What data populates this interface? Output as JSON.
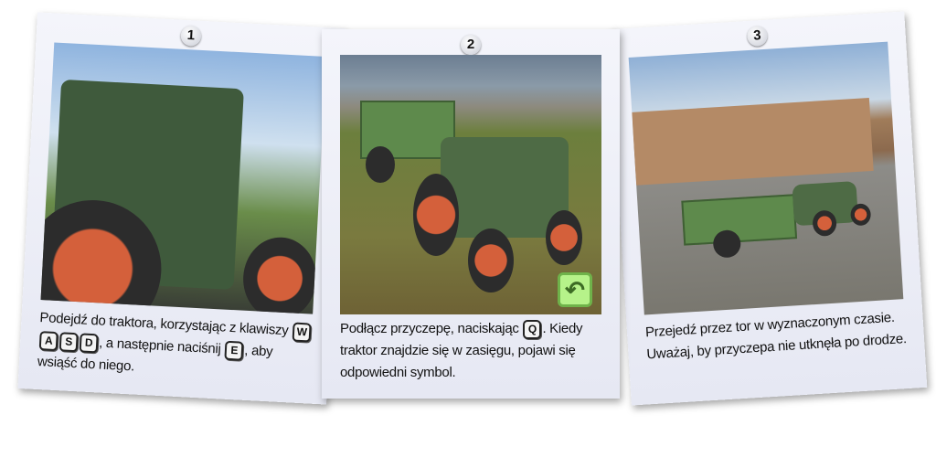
{
  "cards": [
    {
      "number": "1",
      "caption_parts": [
        "Podejdź do traktora, korzystając z klawiszy ",
        ", a następnie naciśnij ",
        ", aby wsiąść do niego."
      ],
      "keys_move": [
        "W",
        "A",
        "S",
        "D"
      ],
      "key_enter": "E"
    },
    {
      "number": "2",
      "caption_parts": [
        "Podłącz przyczepę, naciskając ",
        ". Kiedy traktor znajdzie się w zasięgu, pojawi się odpowiedni symbol."
      ],
      "key_attach": "Q",
      "icon": "attach-symbol-icon",
      "icon_color": "#b6f28a"
    },
    {
      "number": "3",
      "caption": "Przejedź przez tor w wyznaczonym czasie. Uważaj, by przyczepa nie utknęła po drodze."
    }
  ]
}
